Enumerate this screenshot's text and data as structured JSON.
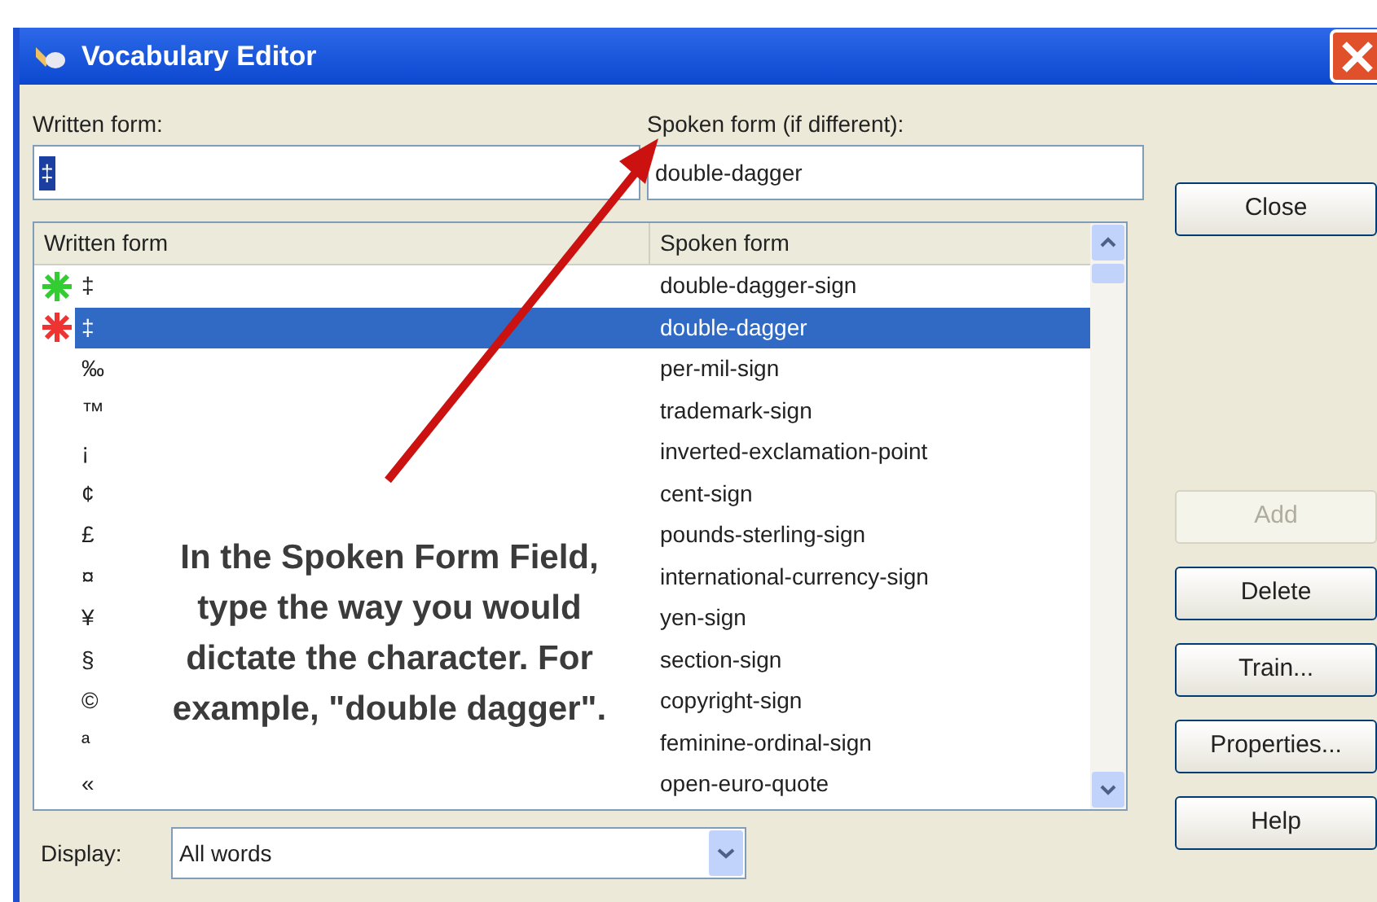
{
  "window": {
    "title": "Vocabulary Editor"
  },
  "written_field": {
    "label": "Written form:",
    "value": "‡"
  },
  "spoken_field": {
    "label": "Spoken form (if different):",
    "value": "double-dagger"
  },
  "list": {
    "columns": [
      "Written form",
      "Spoken form"
    ],
    "rows": [
      {
        "written": "‡",
        "spoken": "double-dagger-sign",
        "selected": false,
        "color": "#33cc33"
      },
      {
        "written": "‡",
        "spoken": "double-dagger",
        "selected": true,
        "color": "#ee3333"
      },
      {
        "written": "‰",
        "spoken": "per-mil-sign",
        "selected": false
      },
      {
        "written": "™",
        "spoken": "trademark-sign",
        "selected": false
      },
      {
        "written": "¡",
        "spoken": "inverted-exclamation-point",
        "selected": false
      },
      {
        "written": "¢",
        "spoken": "cent-sign",
        "selected": false
      },
      {
        "written": "£",
        "spoken": "pounds-sterling-sign",
        "selected": false
      },
      {
        "written": "¤",
        "spoken": "international-currency-sign",
        "selected": false
      },
      {
        "written": "¥",
        "spoken": "yen-sign",
        "selected": false
      },
      {
        "written": "§",
        "spoken": "section-sign",
        "selected": false
      },
      {
        "written": "©",
        "spoken": "copyright-sign",
        "selected": false
      },
      {
        "written": "ª",
        "spoken": "feminine-ordinal-sign",
        "selected": false
      },
      {
        "written": "«",
        "spoken": "open-euro-quote",
        "selected": false
      }
    ]
  },
  "buttons": [
    {
      "label": "Close",
      "disabled": false
    },
    {
      "label": "Add",
      "disabled": true
    },
    {
      "label": "Delete",
      "disabled": false
    },
    {
      "label": "Train...",
      "disabled": false
    },
    {
      "label": "Properties...",
      "disabled": false
    },
    {
      "label": "Help",
      "disabled": false
    }
  ],
  "display": {
    "label": "Display:",
    "value": "All words"
  },
  "annotation": {
    "text": "In the Spoken Form Field, type the way you would dictate the character. For example, \"double dagger\"."
  }
}
